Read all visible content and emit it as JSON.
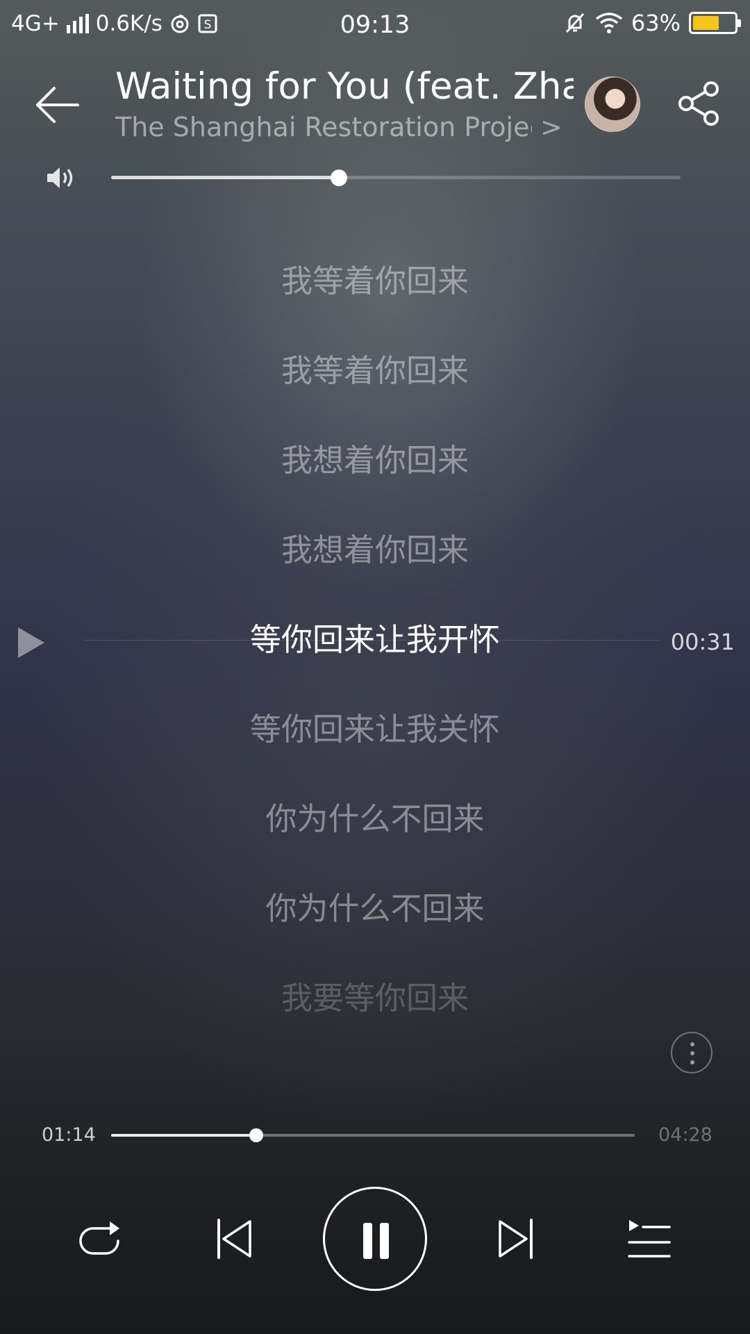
{
  "status_bar": {
    "network": "4G+",
    "speed": "0.6K/s",
    "time": "09:13",
    "battery_percent": "63%",
    "battery_level": 0.63,
    "battery_color": "#f5c518",
    "icons": [
      "signal-icon",
      "netease-icon",
      "sim-s-icon",
      "mute-icon",
      "wifi-icon",
      "battery-icon"
    ]
  },
  "header": {
    "title": "Waiting for You (feat. Zhang",
    "artist": "The Shanghai Restoration Projec···",
    "artist_chevron": ">"
  },
  "volume": {
    "level": 0.4
  },
  "lyrics": {
    "lines": [
      "我等着你回来",
      "我等着你回来",
      "我想着你回来",
      "我想着你回来",
      "等你回来让我开怀",
      "等你回来让我关怀",
      "你为什么不回来",
      "你为什么不回来",
      "我要等你回来"
    ],
    "current_index": 4,
    "seek_time": "00:31"
  },
  "player": {
    "current_time": "01:14",
    "total_time": "04:28",
    "progress": 0.277
  }
}
